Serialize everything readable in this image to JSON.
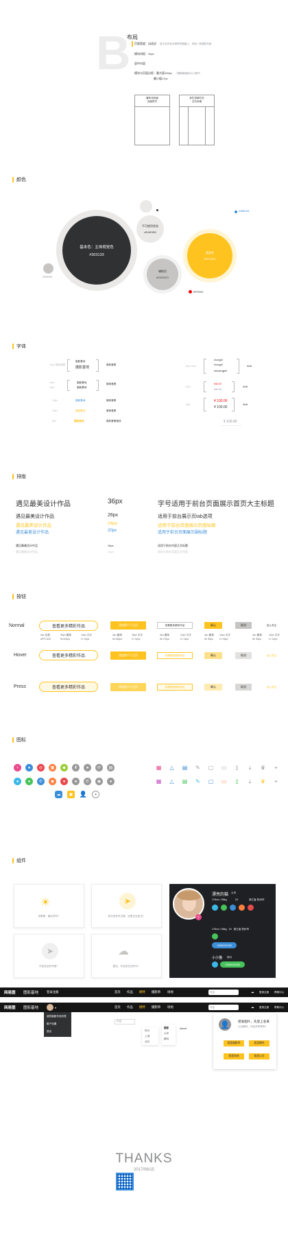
{
  "sections": {
    "layout": "布局",
    "color": "颜色",
    "font": "字体",
    "typesetting": "排版",
    "button": "按钮",
    "icon": "图标",
    "component": "组件"
  },
  "layout": {
    "big_letter": "B",
    "page_width": "页面宽度：自适应",
    "page_width_note": "显示在任何分辨率的屏幕上，采用一种弹性布局",
    "module_gap": "模块间距：20px",
    "center_content": "居中内容",
    "module_size": "模块与页面边距：最大值100px",
    "module_size_note": "（随屏幕缩放大小调节）",
    "min_size": "最小值17px",
    "wire_left": [
      "瀑布流页面",
      "页面样式"
    ],
    "wire_right": [
      "多栏或单栏页",
      "左右布局"
    ]
  },
  "colors": {
    "main_label": "基本色：主体视觉色",
    "main_hex": "#303133",
    "disabled_label": "不可使用状态",
    "disabled_hex": "#EAE9E8",
    "aux_label": "辅助色",
    "aux_hex": "#C6C5C3",
    "brand_label": "高亮色",
    "brand_hex": "#FFC320",
    "small_left": "#999999",
    "small_blue": "#3B8ED8",
    "small_red": "#FF0000",
    "swatch_main": "#303133",
    "swatch_disabled": "#EAE9E8",
    "swatch_aux": "#C6C5C3",
    "swatch_brand": "#FFC320"
  },
  "fonts": {
    "row1_label": "14px 微软雅黑",
    "row1_a": "摄影基地",
    "row1_b": "摄影基地",
    "row1_desc": "微软雅黑",
    "row2_label": "12px",
    "row2_a": "摄影基地",
    "row2_desc": "微软雅黑",
    "row3_label": "10px",
    "row3_a": "摄影基地",
    "row3_desc": "微软雅黑",
    "row4_label": "10px",
    "row4_a": "摄影基地",
    "row4_desc": "微软雅黑",
    "row5_label": "8px",
    "row5_a": "摄影基地",
    "row5_desc": "微软雅黑粗体",
    "right_label1": "12px Arial",
    "right_a": "shungdi",
    "right_b": "shungdi",
    "right_c": "sheyingjidi",
    "right_font1": "Arial",
    "right_price_red": "¥40.00",
    "right_price_gray": "¥40.00",
    "right_font2": "Arial",
    "right_big_red": "¥ 100.00",
    "right_big_dark": "¥ 100.00",
    "right_font3": "Arial",
    "right_big_gray": "¥ 100.00"
  },
  "typeset": {
    "h1": "遇见最美设计作品",
    "h1_size": "36px",
    "h1_desc": "字号适用于前台页面展示首页大主标题",
    "h2a": "遇见最美设计作品",
    "h2b": "遇见最美设计作品",
    "h2c": "遇见最美设计作品",
    "s2a": "26px",
    "s2b": "24px",
    "s2c": "20px",
    "d2a": "适用于前台展示页tab选项",
    "d2b": "适用于前台页面展示页面标题",
    "d2c": "适用于前台页面展示副标题",
    "h3a": "遇见最美设计作品",
    "h3b": "遇见最美设计作品",
    "s3a": "16px",
    "s3b": "14px",
    "d3a": "适用于前台内容正文标题",
    "d3b": "适用于前台页面正文内容"
  },
  "buttons": {
    "states": [
      "Normal",
      "Hover",
      "Press"
    ],
    "big_label": "查看更多精彩作品",
    "yellow_label": "添加到个人主页",
    "outline_label": "查看更多精彩作品",
    "small_yellow": "确认",
    "small_gray": "取消",
    "text_link": "加入关注",
    "spec_1a": "2px 边框",
    "spec_1b": "#FFC320",
    "spec_2a": "30px 圆角",
    "spec_2b": "W:200px",
    "spec_3a": "14px 文字",
    "spec_3b": "H: 32px",
    "spec_4a": "4px 圆角",
    "spec_4b": "W:180px",
    "spec_5a": "16px 文字",
    "spec_5b": "H: 32px",
    "spec_6a": "4px 圆角",
    "spec_6b": "W:170px",
    "spec_7a": "12px 文字",
    "spec_7b": "H: 24px",
    "spec_8a": "4px 圆角",
    "spec_8b": "W: 80px",
    "spec_9a": "14px 文字",
    "spec_9b": "H: 26px",
    "spec_10a": "4px 圆角",
    "spec_10b": "W: 60px",
    "spec_11a": "12px 文字",
    "spec_11b": "H: 24px"
  },
  "icons": {
    "row1_colors": [
      "#e94b8c",
      "#3b8ed8",
      "#e8434a",
      "#ff7f3f",
      "#9acd32",
      "#999999",
      "#999999",
      "#999999",
      "#999999"
    ],
    "row2_colors": [
      "#3bb8e8",
      "#46c35a",
      "#3b8ed8",
      "#ff7f3f",
      "#e84a4a",
      "#999999",
      "#999999",
      "#999999",
      "#999999"
    ],
    "row1_names": [
      "women-icon",
      "user-icon",
      "target-icon",
      "store-icon",
      "android-icon",
      "download-icon",
      "mic-icon",
      "refresh-icon",
      "building-icon"
    ],
    "row2_names": [
      "qq-icon",
      "wechat-icon",
      "phone-icon",
      "camera-icon",
      "weibo-icon",
      "wechat-gray-icon",
      "phone-gray-icon",
      "camera-gray-icon",
      "weibo-gray-icon"
    ],
    "line_row1_names": [
      "grid-icon",
      "triangle-icon",
      "layers-icon",
      "pen-icon",
      "image-icon",
      "badge-icon",
      "doc-icon",
      "download-arrow-icon",
      "trophy-icon",
      "location-icon"
    ],
    "line_row2_names": [
      "grid-color-icon",
      "triangle-color-icon",
      "layers-color-icon",
      "pen-color-icon",
      "image-color-icon",
      "badge-color-icon",
      "doc-color-icon",
      "download-color-icon",
      "trophy-color-icon",
      "location-color-icon"
    ]
  },
  "components": {
    "empty1": "来看看，最近好吗？",
    "empty2": "你还没有写过哦，这里空空如也？",
    "empty3": "作品还没有写哦！",
    "empty4": "暂无，作品还在创作中！",
    "profile_name": "漂亮的猫",
    "profile_badge": "女神",
    "profile_stats": "176cm / 58kg",
    "profile_age": "24",
    "profile_city": "浙江省 杭州市",
    "phone_btn": "13585432455",
    "profile2_name": "小小猫",
    "profile2_badge": "模特",
    "phone_btn2": "13585432455",
    "phone_btn3": "13585432455"
  },
  "nav": {
    "logo": "网易图",
    "logo2": "图影基地",
    "items": [
      "首页",
      "作品",
      "模特",
      "摄影师",
      "场地"
    ],
    "active": "模特",
    "search_placeholder": "作品",
    "right_items": [
      "登录注册",
      "帮助中心"
    ],
    "dropdown": [
      "我的摄影作品列表",
      "账户设置",
      "退出"
    ],
    "filter_cities": [
      "杭州",
      "上海",
      "北京"
    ],
    "filter_types": [
      "摄影",
      "大学",
      "模特"
    ],
    "filter_label": "Aamet"
  },
  "login_popup": {
    "title": "想发图片，先登上名来",
    "subtitle": "以及模特，作品来享受吧！",
    "btns": [
      "我是摄影师",
      "我是模特",
      "我是场地",
      "我是公司"
    ]
  },
  "footer": {
    "thanks": "THANKS",
    "date": "2017/06/15"
  }
}
